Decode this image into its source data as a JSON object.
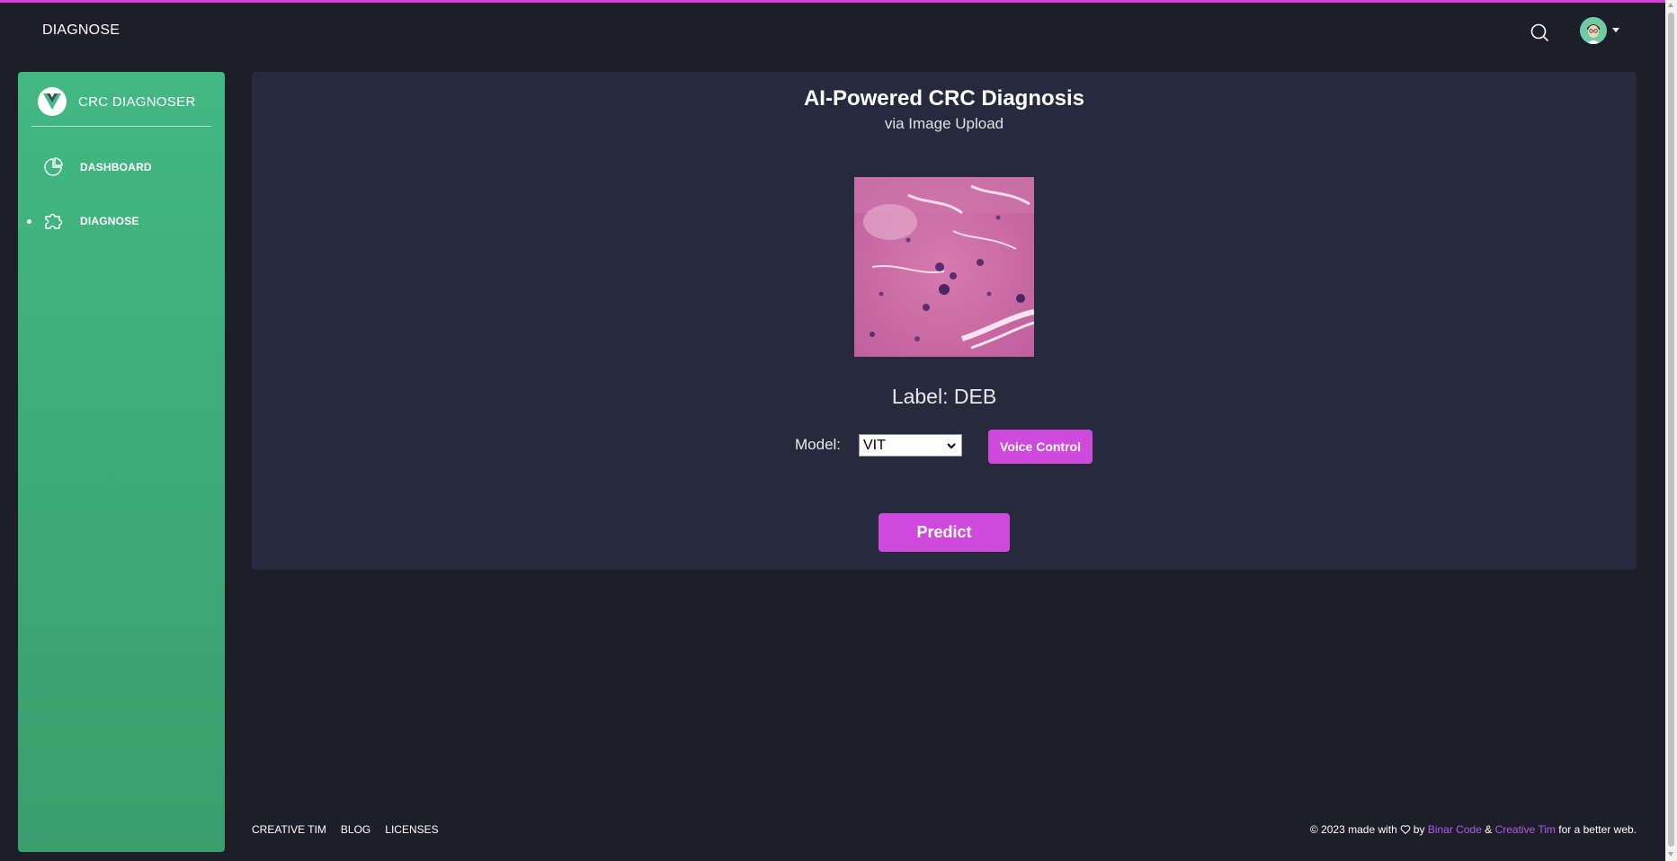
{
  "topbar": {
    "page_title": "DIAGNOSE"
  },
  "sidebar": {
    "brand_name": "CRC DIAGNOSER",
    "items": [
      {
        "label": "DASHBOARD",
        "icon": "pie-chart-icon",
        "active": false
      },
      {
        "label": "DIAGNOSE",
        "icon": "puzzle-icon",
        "active": true
      }
    ]
  },
  "main": {
    "title": "AI-Powered CRC Diagnosis",
    "subtitle": "via Image Upload",
    "label_text": "Label: DEB",
    "model_label": "Model:",
    "model_selected": "VIT",
    "voice_button": "Voice Control",
    "predict_button": "Predict"
  },
  "footer": {
    "links": [
      "CREATIVE TIM",
      "BLOG",
      "LICENSES"
    ],
    "copyright_prefix": "© 2023 made with",
    "by": "by",
    "author1": "Binar Code",
    "amp": "&",
    "author2": "Creative Tim",
    "suffix": "for a better web."
  },
  "colors": {
    "accent": "#d049dd",
    "sidebar": "#42b883",
    "background": "#1e1e2a",
    "card": "#272a3d",
    "link": "#b15ce6"
  }
}
